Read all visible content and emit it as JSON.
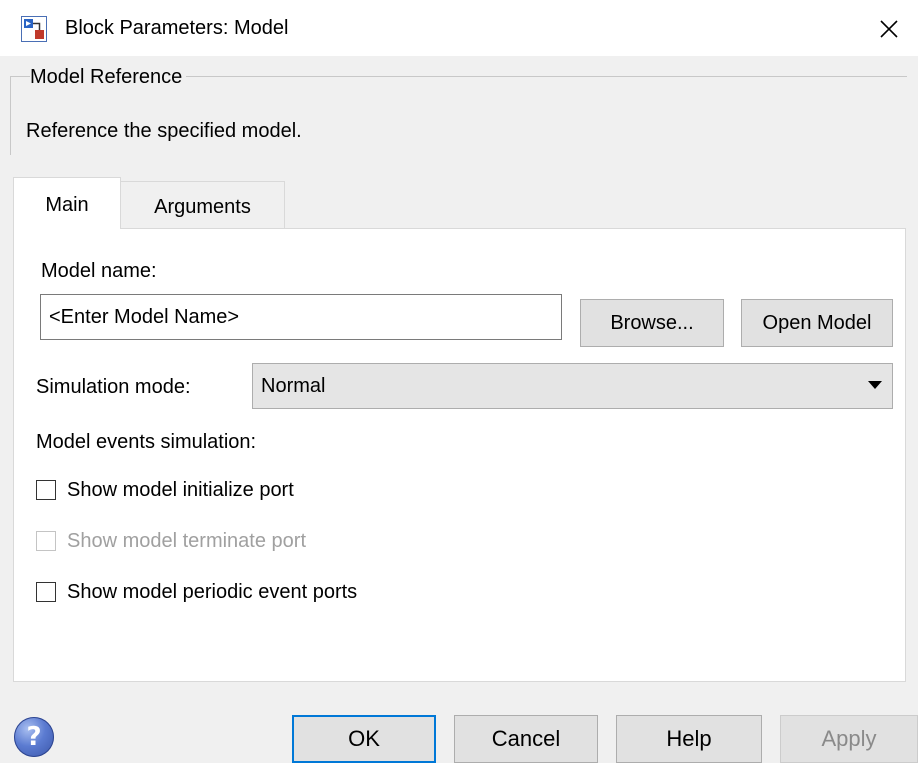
{
  "window": {
    "title": "Block Parameters: Model",
    "icon": "simulink-block-icon",
    "close_icon": "close-icon"
  },
  "group": {
    "legend": "Model Reference",
    "description": "Reference the specified model."
  },
  "tabs": [
    {
      "label": "Main",
      "selected": true
    },
    {
      "label": "Arguments",
      "selected": false
    }
  ],
  "main": {
    "model_name_label": "Model name:",
    "model_name_value": "<Enter Model Name>",
    "browse_label": "Browse...",
    "open_model_label": "Open Model",
    "simulation_mode_label": "Simulation mode:",
    "simulation_mode_value": "Normal",
    "model_events_label": "Model events simulation:",
    "checkboxes": [
      {
        "label": "Show model initialize port",
        "checked": false,
        "enabled": true
      },
      {
        "label": "Show model terminate port",
        "checked": false,
        "enabled": false
      },
      {
        "label": "Show model periodic event ports",
        "checked": false,
        "enabled": true
      }
    ]
  },
  "footer": {
    "help_icon": "question-mark-icon",
    "ok_label": "OK",
    "cancel_label": "Cancel",
    "help_label": "Help",
    "apply_label": "Apply",
    "apply_enabled": false
  },
  "colors": {
    "focus_border": "#0078d7",
    "dialog_background": "#f0f0f0",
    "panel_background": "#ffffff",
    "disabled_text": "#a0a0a0"
  }
}
